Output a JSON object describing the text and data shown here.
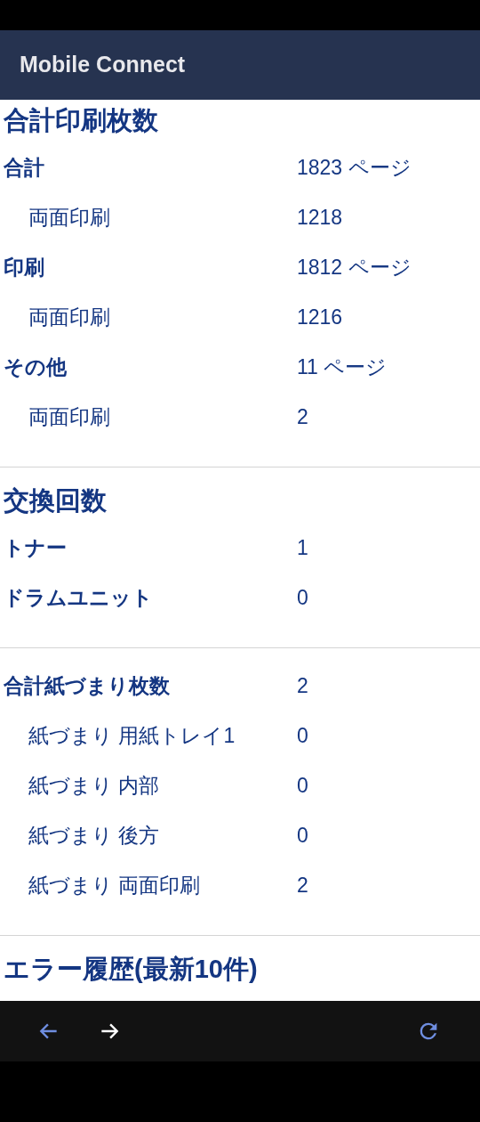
{
  "app_bar": {
    "title": "Mobile Connect"
  },
  "sections": [
    {
      "title": "合計印刷枚数",
      "rows": [
        {
          "label": "合計",
          "value": "1823 ページ",
          "children": [
            {
              "label": "両面印刷",
              "value": "1218"
            }
          ]
        },
        {
          "label": "印刷",
          "value": "1812 ページ",
          "children": [
            {
              "label": "両面印刷",
              "value": "1216"
            }
          ]
        },
        {
          "label": "その他",
          "value": "11 ページ",
          "children": [
            {
              "label": "両面印刷",
              "value": "2"
            }
          ]
        }
      ]
    },
    {
      "title": "交換回数",
      "rows": [
        {
          "label": "トナー",
          "value": "1"
        },
        {
          "label": "ドラムユニット",
          "value": "0"
        }
      ]
    },
    {
      "rows": [
        {
          "label": "合計紙づまり枚数",
          "value": "2",
          "children": [
            {
              "label": "紙づまり 用紙トレイ1",
              "value": "0"
            },
            {
              "label": "紙づまり 内部",
              "value": "0"
            },
            {
              "label": "紙づまり 後方",
              "value": "0"
            },
            {
              "label": "紙づまり 両面印刷",
              "value": "2"
            }
          ]
        }
      ]
    },
    {
      "title": "エラー履歴(最新10件)"
    }
  ]
}
